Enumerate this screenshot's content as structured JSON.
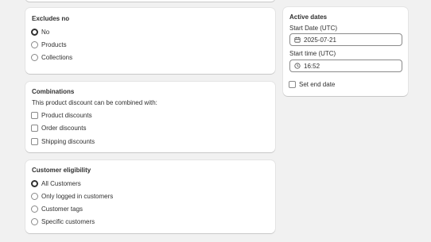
{
  "excludes": {
    "title": "Excludes no",
    "options": [
      {
        "label": "No",
        "checked": true
      },
      {
        "label": "Products",
        "checked": false
      },
      {
        "label": "Collections",
        "checked": false
      }
    ]
  },
  "combinations": {
    "title": "Combinations",
    "description": "This product discount can be combined with:",
    "options": [
      {
        "label": "Product discounts",
        "checked": false
      },
      {
        "label": "Order discounts",
        "checked": false
      },
      {
        "label": "Shipping discounts",
        "checked": false
      }
    ]
  },
  "eligibility": {
    "title": "Customer eligibility",
    "options": [
      {
        "label": "All Customers",
        "checked": true
      },
      {
        "label": "Only logged in customers",
        "checked": false
      },
      {
        "label": "Customer tags",
        "checked": false
      },
      {
        "label": "Specific customers",
        "checked": false
      }
    ]
  },
  "active_dates": {
    "title": "Active dates",
    "start_date_label": "Start Date (UTC)",
    "start_date_value": "2025-07-21",
    "start_date_icon": "calendar-icon",
    "start_time_label": "Start time (UTC)",
    "start_time_value": "16:52",
    "start_time_icon": "clock-icon",
    "set_end_date_label": "Set end date",
    "set_end_date_checked": false
  }
}
